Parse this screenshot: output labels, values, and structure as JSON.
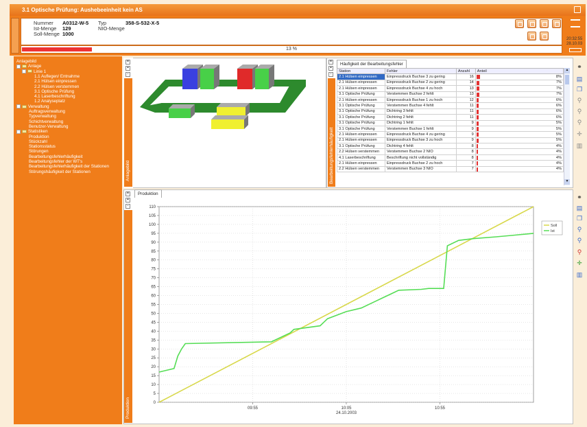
{
  "window": {
    "title": "3.1 Optische Prüfung: Aushebeeinheit kein AS"
  },
  "header": {
    "nummer_label": "Nummer",
    "nummer_value": "A0312-W-5",
    "typ_label": "Typ",
    "typ_value": "358-S-532-X-5",
    "ist_label": "Ist-Menge",
    "ist_value": "129",
    "nio_label": "NIO-Menge",
    "soll_label": "Soll-Menge",
    "soll_value": "1000",
    "progress_text": "13 %",
    "progress_fraction": 0.13,
    "clock_time": "20:32:55",
    "clock_date": "28.10.03"
  },
  "tree": [
    {
      "label": "Anlagebild",
      "level": 0,
      "node": "none"
    },
    {
      "label": "Anlage",
      "level": 0,
      "node": "folder"
    },
    {
      "label": "Linie 1",
      "level": 1,
      "node": "folder"
    },
    {
      "label": "1.1 Auflegen/ Entnahme",
      "level": 2,
      "node": "none"
    },
    {
      "label": "2.1 Hülsen einpressen",
      "level": 2,
      "node": "none"
    },
    {
      "label": "2.2 Hülsen verstemmen",
      "level": 2,
      "node": "none"
    },
    {
      "label": "3.1 Optische Prüfung",
      "level": 2,
      "node": "none"
    },
    {
      "label": "4.1 Laserbeschriftung",
      "level": 2,
      "node": "none"
    },
    {
      "label": "1.2 Analyseplatz",
      "level": 2,
      "node": "none"
    },
    {
      "label": "Verwaltung",
      "level": 0,
      "node": "folder"
    },
    {
      "label": "Auftragsverwaltung",
      "level": 1,
      "node": "none"
    },
    {
      "label": "Typverwaltung",
      "level": 1,
      "node": "none"
    },
    {
      "label": "Schichtverwaltung",
      "level": 1,
      "node": "none"
    },
    {
      "label": "Benutzer-Verwaltung",
      "level": 1,
      "node": "none"
    },
    {
      "label": "Statistiken",
      "level": 0,
      "node": "folder"
    },
    {
      "label": "Produktion",
      "level": 1,
      "node": "none"
    },
    {
      "label": "Stückzahl",
      "level": 1,
      "node": "none"
    },
    {
      "label": "Stationsstatus",
      "level": 1,
      "node": "none"
    },
    {
      "label": "Störungen",
      "level": 1,
      "node": "none"
    },
    {
      "label": "Bearbeitungsfehlerhäufigkeit",
      "level": 1,
      "node": "none"
    },
    {
      "label": "Bearbeitungsfehler der WT's",
      "level": 1,
      "node": "none"
    },
    {
      "label": "Bearbeitungsfehlerhäufigkeit der Stationen",
      "level": 1,
      "node": "none"
    },
    {
      "label": "Störungshäufigkeit der Stationen",
      "level": 1,
      "node": "none"
    }
  ],
  "anlage_panel": {
    "side_label": "Anlagebild"
  },
  "error_table": {
    "tab_label": "Häufigkeit der Bearbeitungsfehler",
    "side_label": "Bearbeitungsfehlerhäufigkeit",
    "columns": [
      "Station",
      "Fehler",
      "Anzahl",
      "Anteil"
    ],
    "bar_color": "#e33333",
    "rows": [
      {
        "station": "2.1 Hülsen einpressen",
        "fehler": "Einpressdruck Buchse 3 zu gering",
        "anzahl": "16",
        "anteil": "8%",
        "frac": 0.08
      },
      {
        "station": "2.1 Hülsen einpressen",
        "fehler": "Einpressdruck Buchse 2 zu gering",
        "anzahl": "14",
        "anteil": "7%",
        "frac": 0.07
      },
      {
        "station": "2.1 Hülsen einpressen",
        "fehler": "Einpressdruck Buchse 4 zu hoch",
        "anzahl": "13",
        "anteil": "7%",
        "frac": 0.07
      },
      {
        "station": "3.1 Optische Prüfung",
        "fehler": "Verstemmen Buchse 2 fehlt",
        "anzahl": "13",
        "anteil": "7%",
        "frac": 0.07
      },
      {
        "station": "2.1 Hülsen einpressen",
        "fehler": "Einpressdruck Buchse 1 zu hoch",
        "anzahl": "12",
        "anteil": "6%",
        "frac": 0.06
      },
      {
        "station": "3.1 Optische Prüfung",
        "fehler": "Verstemmen Buchse 4 fehlt",
        "anzahl": "11",
        "anteil": "6%",
        "frac": 0.06
      },
      {
        "station": "3.1 Optische Prüfung",
        "fehler": "Dichtring 3 fehlt",
        "anzahl": "11",
        "anteil": "6%",
        "frac": 0.06
      },
      {
        "station": "3.1 Optische Prüfung",
        "fehler": "Dichtring 2 fehlt",
        "anzahl": "11",
        "anteil": "6%",
        "frac": 0.06
      },
      {
        "station": "3.1 Optische Prüfung",
        "fehler": "Dichtring 1 fehlt",
        "anzahl": "9",
        "anteil": "5%",
        "frac": 0.05
      },
      {
        "station": "3.1 Optische Prüfung",
        "fehler": "Verstemmen Buchse 1 fehlt",
        "anzahl": "9",
        "anteil": "5%",
        "frac": 0.05
      },
      {
        "station": "2.1 Hülsen einpressen",
        "fehler": "Einpressdruck Buchse 4 zu gering",
        "anzahl": "9",
        "anteil": "5%",
        "frac": 0.05
      },
      {
        "station": "2.1 Hülsen einpressen",
        "fehler": "Einpressdruck Buchse 3 zu hoch",
        "anzahl": "9",
        "anteil": "5%",
        "frac": 0.05
      },
      {
        "station": "3.1 Optische Prüfung",
        "fehler": "Dichtring 4 fehlt",
        "anzahl": "8",
        "anteil": "4%",
        "frac": 0.04
      },
      {
        "station": "2.2 Hülsen verstemmen",
        "fehler": "Verstemmen Buchse 2 NIO",
        "anzahl": "8",
        "anteil": "4%",
        "frac": 0.04
      },
      {
        "station": "4.1 Laserbeschriftung",
        "fehler": "Beschriftung nicht vollständig",
        "anzahl": "8",
        "anteil": "4%",
        "frac": 0.04
      },
      {
        "station": "2.1 Hülsen einpressen",
        "fehler": "Einpressdruck Buchse 2 zu hoch",
        "anzahl": "7",
        "anteil": "4%",
        "frac": 0.04
      },
      {
        "station": "2.2 Hülsen verstemmen",
        "fehler": "Verstemmen Buchse 3 NIO",
        "anzahl": "7",
        "anteil": "4%",
        "frac": 0.04
      }
    ]
  },
  "chart_panel": {
    "tab_label": "Produktion",
    "side_label": "Produktion"
  },
  "chart_data": {
    "type": "line",
    "title": "",
    "xlabel": "",
    "ylabel": "",
    "x_ticks": [
      "09:55",
      "10:05",
      "10:55"
    ],
    "x_date": "24.10.2003",
    "ylim": [
      0,
      110
    ],
    "y_ticks": [
      0,
      5,
      10,
      15,
      20,
      25,
      30,
      35,
      40,
      45,
      50,
      55,
      60,
      65,
      70,
      75,
      80,
      85,
      90,
      95,
      100,
      105,
      110
    ],
    "grid": true,
    "legend_position": "top-right",
    "series": [
      {
        "name": "Soll",
        "color": "#d8d84a",
        "points": [
          [
            0,
            0
          ],
          [
            100,
            110
          ]
        ]
      },
      {
        "name": "Ist",
        "color": "#55dd55",
        "points": [
          [
            0,
            17
          ],
          [
            2,
            18
          ],
          [
            4,
            19
          ],
          [
            5,
            26
          ],
          [
            6,
            30
          ],
          [
            7,
            33
          ],
          [
            30,
            34
          ],
          [
            33,
            37
          ],
          [
            35,
            39
          ],
          [
            36,
            41
          ],
          [
            43,
            43
          ],
          [
            44,
            45
          ],
          [
            45,
            47
          ],
          [
            50,
            51
          ],
          [
            54,
            53
          ],
          [
            58,
            57
          ],
          [
            60,
            59
          ],
          [
            62,
            61
          ],
          [
            64,
            63
          ],
          [
            70,
            63.5
          ],
          [
            72,
            64
          ],
          [
            76,
            64
          ],
          [
            77,
            88
          ],
          [
            80,
            91
          ],
          [
            84,
            92
          ],
          [
            90,
            93
          ],
          [
            95,
            94
          ],
          [
            100,
            95
          ]
        ]
      }
    ]
  }
}
